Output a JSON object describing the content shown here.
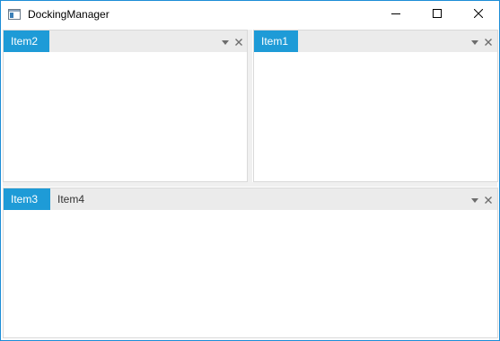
{
  "window": {
    "title": "DockingManager",
    "icon": "app-window-icon",
    "controls": [
      "minimize-icon",
      "maximize-icon",
      "close-icon"
    ]
  },
  "panes": {
    "top_left": {
      "tabs": [
        {
          "label": "Item2",
          "active": true
        }
      ],
      "menu_icon": "dropdown-arrow-icon",
      "close_icon": "close-icon"
    },
    "top_right": {
      "tabs": [
        {
          "label": "Item1",
          "active": true
        }
      ],
      "menu_icon": "dropdown-arrow-icon",
      "close_icon": "close-icon"
    },
    "bottom": {
      "tabs": [
        {
          "label": "Item3",
          "active": true
        },
        {
          "label": "Item4",
          "active": false
        }
      ],
      "menu_icon": "dropdown-arrow-icon",
      "close_icon": "close-icon"
    }
  },
  "colors": {
    "accent": "#1e9bd7",
    "header_bg": "#ebebeb",
    "window_border": "#1c8dd6"
  }
}
